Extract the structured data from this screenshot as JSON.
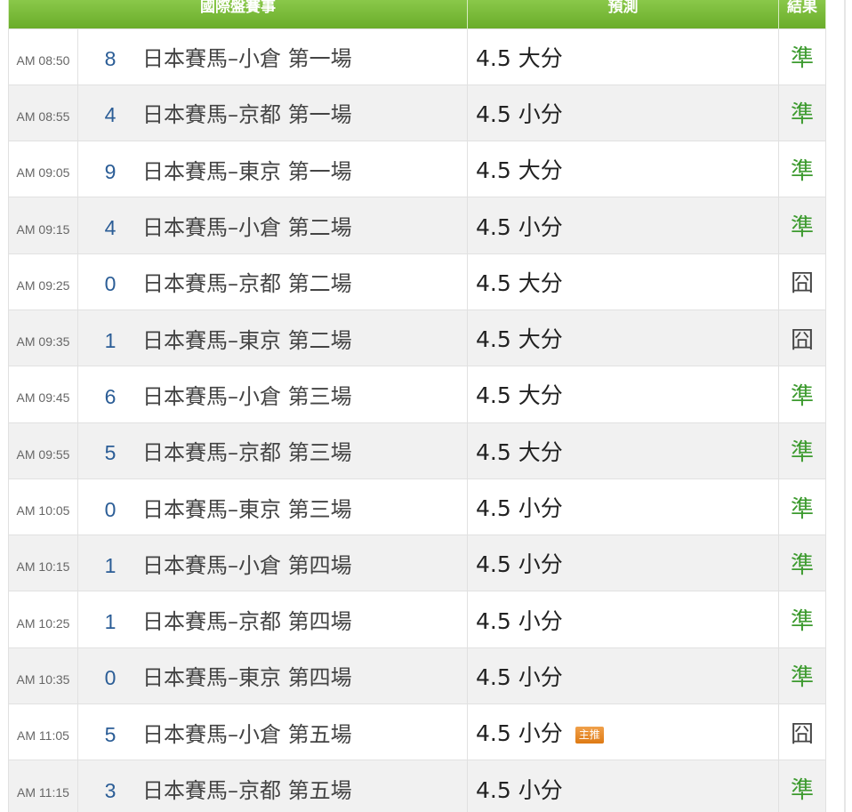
{
  "header": {
    "event_label": "國際盤賽事",
    "prediction_label": "預測",
    "result_label": "結果"
  },
  "colors": {
    "header_green": "#79b83a",
    "hit_green": "#3c9a2e",
    "race_number_blue": "#2b5d96",
    "badge_orange": "#e88a26"
  },
  "rows": [
    {
      "time": "AM 08:50",
      "number": "8",
      "race": "日本賽馬–小倉 第一場",
      "prediction": "4.5 大分",
      "badge": "",
      "result": "準",
      "hit": true
    },
    {
      "time": "AM 08:55",
      "number": "4",
      "race": "日本賽馬–京都 第一場",
      "prediction": "4.5 小分",
      "badge": "",
      "result": "準",
      "hit": true
    },
    {
      "time": "AM 09:05",
      "number": "9",
      "race": "日本賽馬–東京 第一場",
      "prediction": "4.5 大分",
      "badge": "",
      "result": "準",
      "hit": true
    },
    {
      "time": "AM 09:15",
      "number": "4",
      "race": "日本賽馬–小倉 第二場",
      "prediction": "4.5 小分",
      "badge": "",
      "result": "準",
      "hit": true
    },
    {
      "time": "AM 09:25",
      "number": "0",
      "race": "日本賽馬–京都 第二場",
      "prediction": "4.5 大分",
      "badge": "",
      "result": "囧",
      "hit": false
    },
    {
      "time": "AM 09:35",
      "number": "1",
      "race": "日本賽馬–東京 第二場",
      "prediction": "4.5 大分",
      "badge": "",
      "result": "囧",
      "hit": false
    },
    {
      "time": "AM 09:45",
      "number": "6",
      "race": "日本賽馬–小倉 第三場",
      "prediction": "4.5 大分",
      "badge": "",
      "result": "準",
      "hit": true
    },
    {
      "time": "AM 09:55",
      "number": "5",
      "race": "日本賽馬–京都 第三場",
      "prediction": "4.5 大分",
      "badge": "",
      "result": "準",
      "hit": true
    },
    {
      "time": "AM 10:05",
      "number": "0",
      "race": "日本賽馬–東京 第三場",
      "prediction": "4.5 小分",
      "badge": "",
      "result": "準",
      "hit": true
    },
    {
      "time": "AM 10:15",
      "number": "1",
      "race": "日本賽馬–小倉 第四場",
      "prediction": "4.5 小分",
      "badge": "",
      "result": "準",
      "hit": true
    },
    {
      "time": "AM 10:25",
      "number": "1",
      "race": "日本賽馬–京都 第四場",
      "prediction": "4.5 小分",
      "badge": "",
      "result": "準",
      "hit": true
    },
    {
      "time": "AM 10:35",
      "number": "0",
      "race": "日本賽馬–東京 第四場",
      "prediction": "4.5 小分",
      "badge": "",
      "result": "準",
      "hit": true
    },
    {
      "time": "AM 11:05",
      "number": "5",
      "race": "日本賽馬–小倉 第五場",
      "prediction": "4.5 小分",
      "badge": "主推",
      "result": "囧",
      "hit": false
    },
    {
      "time": "AM 11:15",
      "number": "3",
      "race": "日本賽馬–京都 第五場",
      "prediction": "4.5 小分",
      "badge": "",
      "result": "準",
      "hit": true
    }
  ]
}
